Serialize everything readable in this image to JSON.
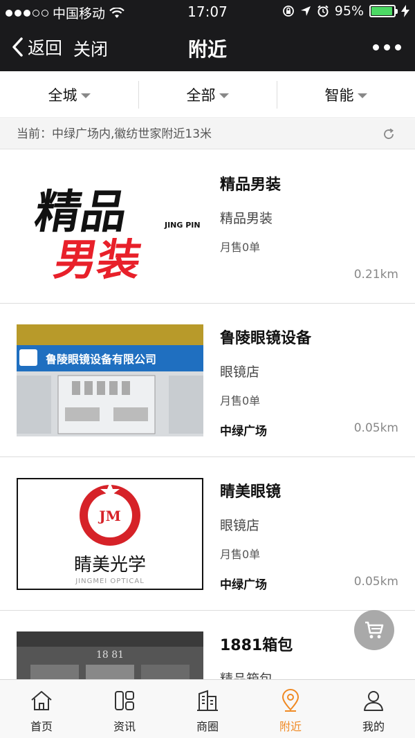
{
  "status_bar": {
    "carrier": "中国移动",
    "time": "17:07",
    "battery": "95%",
    "battery_level": 0.95
  },
  "nav": {
    "back_label": "返回",
    "close_label": "关闭",
    "title": "附近"
  },
  "filters": [
    {
      "label": "全城"
    },
    {
      "label": "全部"
    },
    {
      "label": "智能"
    }
  ],
  "location": {
    "text": "当前：中绿广场内,徽纺世家附近13米"
  },
  "stores": [
    {
      "name": "精品男装",
      "category": "精品男装",
      "sales": "月售0单",
      "area": "",
      "distance": "0.21km",
      "logo_text_top": "精品",
      "logo_text_bottom": "男装",
      "logo_side": "JING PIN"
    },
    {
      "name": "鲁陵眼镜设备",
      "category": "眼镜店",
      "sales": "月售0单",
      "area": "中绿广场",
      "distance": "0.05km",
      "sign_text": "鲁陵眼镜设备有限公司"
    },
    {
      "name": "睛美眼镜",
      "category": "眼镜店",
      "sales": "月售0单",
      "area": "中绿广场",
      "distance": "0.05km",
      "logo_cn": "睛美光学",
      "logo_en": "JINGMEI OPTICAL",
      "logo_badge": "JM"
    },
    {
      "name": "1881箱包",
      "category": "精品箱包",
      "sales": "",
      "area": "",
      "distance": "",
      "sign_text": "18 81"
    }
  ],
  "tabs": [
    {
      "label": "首页",
      "icon": "home-icon"
    },
    {
      "label": "资讯",
      "icon": "news-icon"
    },
    {
      "label": "商圈",
      "icon": "building-icon"
    },
    {
      "label": "附近",
      "icon": "location-pin-icon",
      "active": true
    },
    {
      "label": "我的",
      "icon": "user-icon"
    }
  ],
  "colors": {
    "active_tab": "#f08a24",
    "nav_bg": "#1a1a1c"
  }
}
